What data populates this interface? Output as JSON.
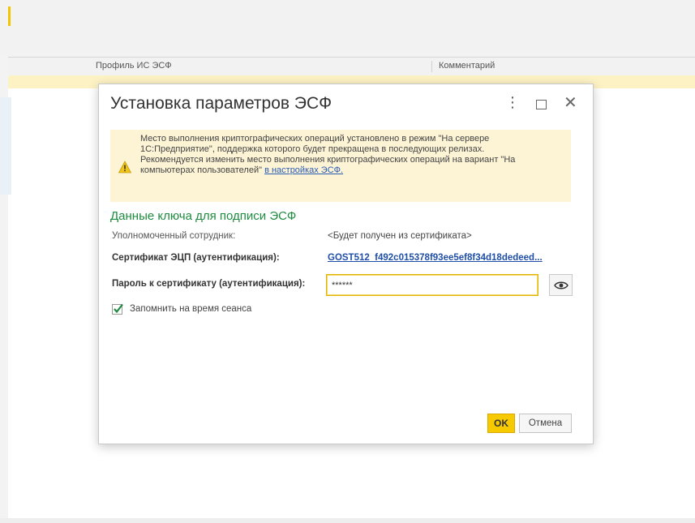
{
  "grid": {
    "columns": [
      "Профиль ИС ЭСФ",
      "Комментарий"
    ]
  },
  "dialog": {
    "title": "Установка параметров ЭСФ",
    "menu_glyph": "⋮",
    "close_glyph": "✕",
    "warning": {
      "text": "Место выполнения криптографических операций установлено в режим \"На сервере 1С:Предприятие\", поддержка которого будет прекращена в последующих релизах.\nРекомендуется изменить место выполнения криптографических операций на вариант \"На компьютерах пользователей\" ",
      "link_text": "в настройках ЭСФ.",
      "icon": "warning-triangle-icon"
    },
    "section_title": "Данные ключа для подписи ЭСФ",
    "fields": {
      "employee_label": "Уполномоченный сотрудник:",
      "employee_value": "<Будет получен из сертификата>",
      "cert_label": "Сертификат ЭЦП (аутентификация):",
      "cert_value": "GOST512_f492c015378f93ee5ef8f34d18dedeed...",
      "password_label": "Пароль к сертификату (аутентификация):",
      "password_value": "******"
    },
    "remember": {
      "label": "Запомнить на время сеанса",
      "checked": true
    },
    "buttons": {
      "ok": "OK",
      "cancel": "Отмена"
    },
    "colors": {
      "accent_yellow": "#f7c900",
      "section_green": "#1e8b3f",
      "warning_bg": "#fdf4d6",
      "link_blue": "#1f4fa8"
    }
  }
}
